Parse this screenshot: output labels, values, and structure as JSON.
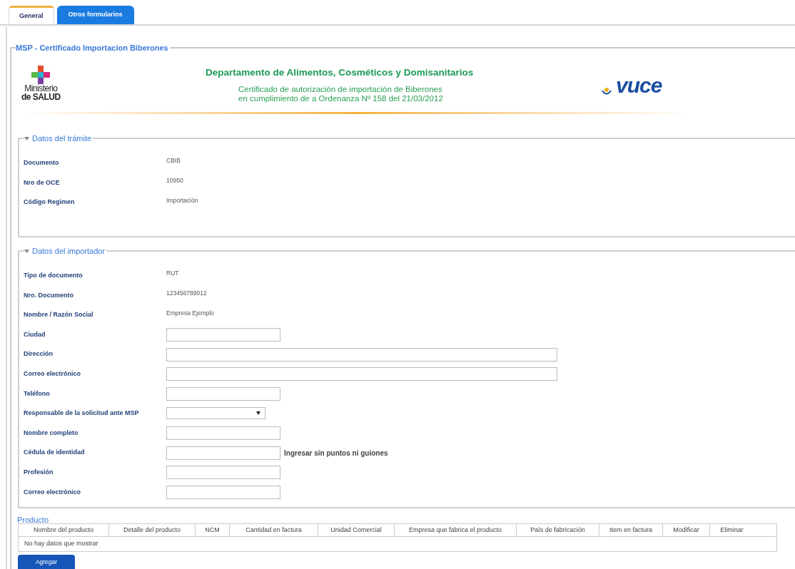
{
  "tabs": [
    {
      "label": "General",
      "selected": true
    },
    {
      "label": "Otros formularios",
      "selected": false
    }
  ],
  "form_title": "MSP - Certificado Importacion Biberones",
  "banner": {
    "ministry_logo": [
      "Ministerio",
      "de SALUD"
    ],
    "department": "Departamento de Alimentos, Cosméticos y Domisanitarios",
    "subtitle": [
      "Certificado de autorización de importación de Biberones",
      "en cumplimiento de a Ordenanza Nº 158 del 21/03/2012"
    ],
    "vuce_logo": "vuce"
  },
  "sections": [
    {
      "title": "Datos del trámite",
      "expanded": true,
      "fields": [
        {
          "label": "Documento",
          "kind": "text",
          "value": "CBIB"
        },
        {
          "label": "Nro de OCE",
          "kind": "text",
          "value": "10950"
        },
        {
          "label": "Código Regimen",
          "kind": "text",
          "value": "Importación"
        }
      ]
    },
    {
      "title": "Datos del importador",
      "expanded": true,
      "fields": [
        {
          "label": "Tipo de documento",
          "kind": "text",
          "value": "RUT"
        },
        {
          "label": "Nro. Documento",
          "kind": "text",
          "value": "123456789012"
        },
        {
          "label": "Nombre / Razón Social",
          "kind": "text",
          "value": "Empresa Ejemplo"
        },
        {
          "label": "Ciudad",
          "kind": "input"
        },
        {
          "label": "Dirección",
          "kind": "wide_input"
        },
        {
          "label": "Correo electrónico",
          "kind": "wide_input"
        },
        {
          "label": "Teléfono",
          "kind": "input"
        },
        {
          "label": "Responsable de la solicitud ante MSP",
          "kind": "select"
        },
        {
          "label": "Nombre completo",
          "kind": "input"
        },
        {
          "label": "Cédula de identidad",
          "kind": "input",
          "hint": "Ingresar sin puntos ni guiones"
        },
        {
          "label": "Profesión",
          "kind": "input"
        },
        {
          "label": "Correo electrónico",
          "kind": "input"
        }
      ]
    }
  ],
  "product": {
    "title": "Producto",
    "columns": [
      "Nombre del producto",
      "Detalle del producto",
      "NCM",
      "Cantidad en factura",
      "Unidad Comercial",
      "Empresa que fabrica el producto",
      "País de fabricación",
      "Item en factura",
      "Modificar",
      "Eliminar"
    ],
    "empty_message": "No hay datos que mostrar",
    "add_button": "Agregar"
  }
}
